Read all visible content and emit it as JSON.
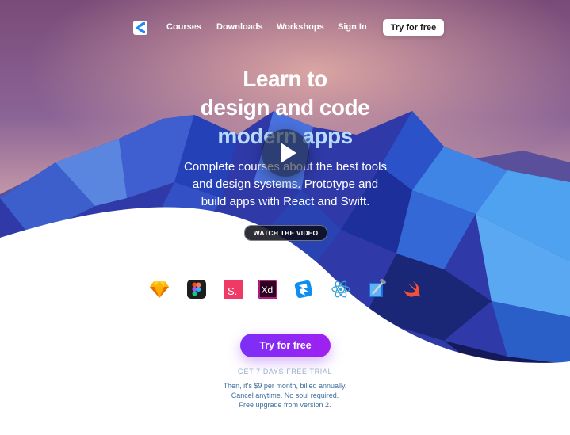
{
  "nav": {
    "links": [
      "Courses",
      "Downloads",
      "Workshops",
      "Sign In"
    ],
    "cta_label": "Try for free"
  },
  "hero": {
    "title_line1": "Learn to",
    "title_line2": "design and code",
    "title_line3": "modern apps",
    "subtitle": "Complete courses about the best tools and design systems. Prototype and build apps with React and Swift.",
    "watch_label": "WATCH THE VIDEO"
  },
  "tools": {
    "icons": [
      "sketch-icon",
      "figma-icon",
      "studio-icon",
      "xd-icon",
      "framer-icon",
      "react-icon",
      "xcode-icon",
      "swift-icon"
    ],
    "studio_letter": "S.",
    "xd_letters": "Xd"
  },
  "signup": {
    "cta_label": "Try for free",
    "trial_label": "GET 7 DAYS FREE TRIAL",
    "fine_print": [
      "Then, it's $9 per month, billed annually.",
      "Cancel anytime. No soul required.",
      "Free upgrade from version 2."
    ]
  },
  "colors": {
    "accent_start": "#7b2ff7",
    "accent_end": "#a020f0",
    "link_blue": "#3d6ea0"
  }
}
